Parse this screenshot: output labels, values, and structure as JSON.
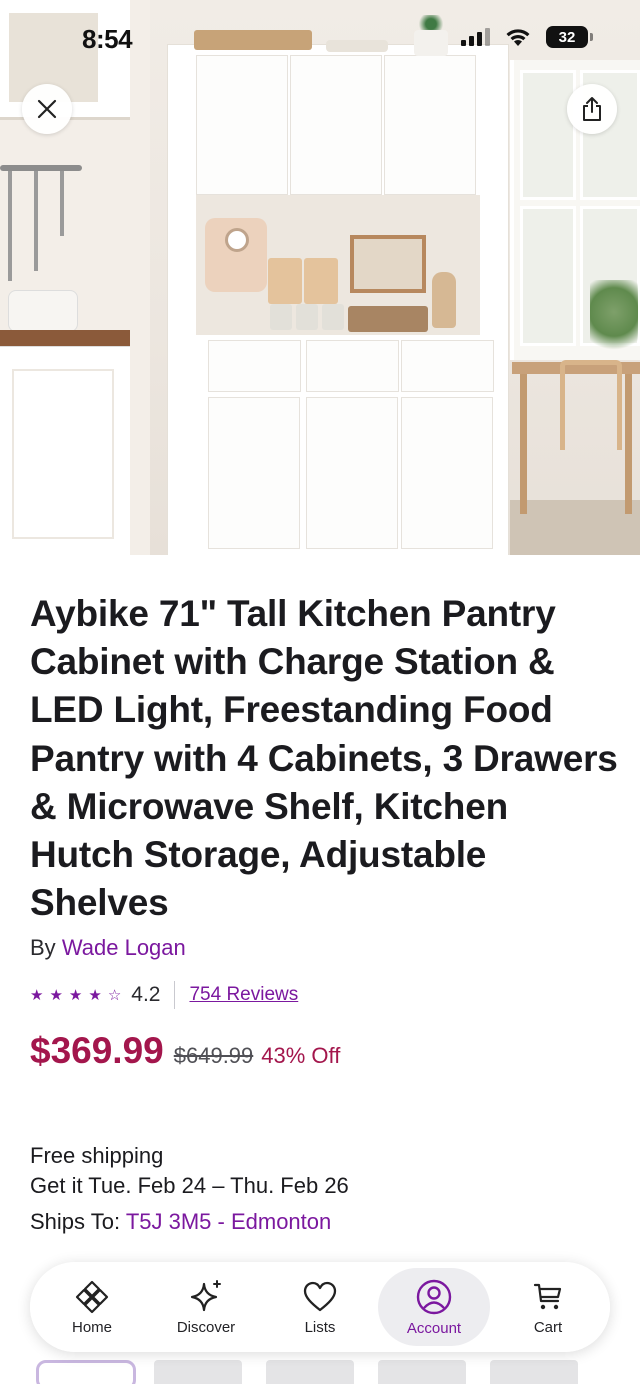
{
  "status_bar": {
    "time": "8:54",
    "battery": "32"
  },
  "hero": {
    "close_icon": "close-icon",
    "share_icon": "share-icon"
  },
  "product": {
    "title": "Aybike 71\" Tall Kitchen Pantry Cabinet with Charge Station & LED Light, Freestanding Food Pantry with 4 Cabinets, 3 Drawers & Microwave Shelf, Kitchen Hutch Storage, Adjustable Shelves",
    "by_prefix": "By",
    "brand": "Wade Logan",
    "rating": "4.2",
    "rating_fraction": 0.84,
    "stars": {
      "filled": 4,
      "total": 5
    },
    "reviews": "754 Reviews",
    "price": "$369.99",
    "old_price": "$649.99",
    "discount": "43% Off"
  },
  "shipping": {
    "free": "Free shipping",
    "delivery": "Get it Tue. Feb 24 – Thu. Feb 26",
    "ships_to_label": "Ships To:",
    "ships_to_location": "T5J 3M5 - Edmonton"
  },
  "nav": {
    "items": [
      {
        "label": "Home",
        "icon": "home-icon"
      },
      {
        "label": "Discover",
        "icon": "sparkle-icon"
      },
      {
        "label": "Lists",
        "icon": "heart-icon"
      },
      {
        "label": "Account",
        "icon": "user-icon",
        "active": true
      },
      {
        "label": "Cart",
        "icon": "cart-icon"
      }
    ]
  },
  "colors": {
    "accent_purple": "#7b189f",
    "price_red": "#a3164c",
    "active_nav_bg": "#ededf0"
  }
}
